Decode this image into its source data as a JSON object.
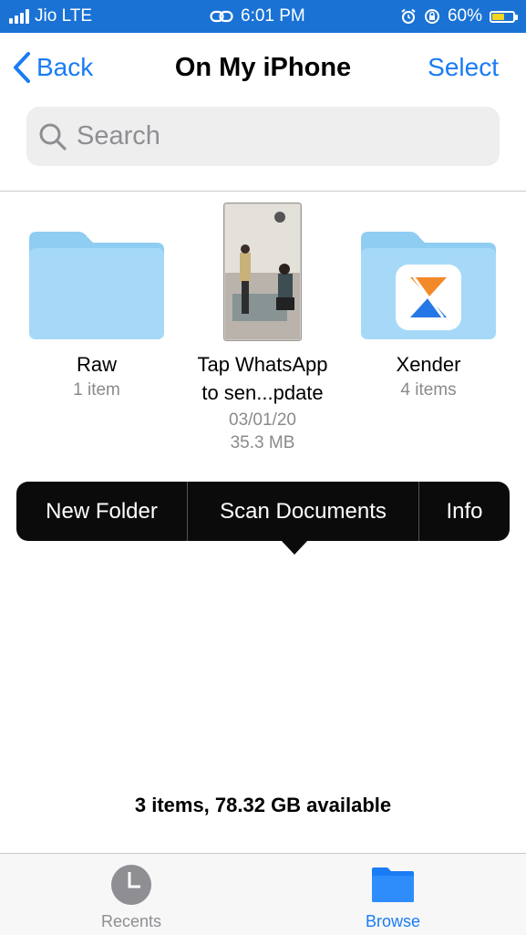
{
  "status_bar": {
    "carrier": "Jio LTE",
    "time": "6:01 PM",
    "battery_percent": "60%",
    "battery_level": 0.6,
    "colors": {
      "background": "#1a72d4",
      "battery": "#f5d31f"
    }
  },
  "nav": {
    "back_label": "Back",
    "title": "On My iPhone",
    "select_label": "Select"
  },
  "search": {
    "placeholder": "Search"
  },
  "items": [
    {
      "name": "Raw",
      "meta": "1 item",
      "icon": "folder-icon"
    },
    {
      "name_line1": "Tap WhatsApp",
      "name_line2": "to sen...pdate",
      "date": "03/01/20",
      "size": "35.3 MB",
      "icon": "video-thumbnail"
    },
    {
      "name": "Xender",
      "meta": "4 items",
      "icon": "xender-folder-icon"
    }
  ],
  "context_menu": {
    "items": [
      "New Folder",
      "Scan Documents",
      "Info"
    ]
  },
  "storage_summary": "3 items, 78.32 GB available",
  "tab_bar": {
    "tabs": [
      {
        "label": "Recents",
        "icon": "clock-icon",
        "active": false
      },
      {
        "label": "Browse",
        "icon": "folder-icon",
        "active": true
      }
    ],
    "colors": {
      "active": "#1a7cf5",
      "inactive": "#8e8e93"
    }
  }
}
